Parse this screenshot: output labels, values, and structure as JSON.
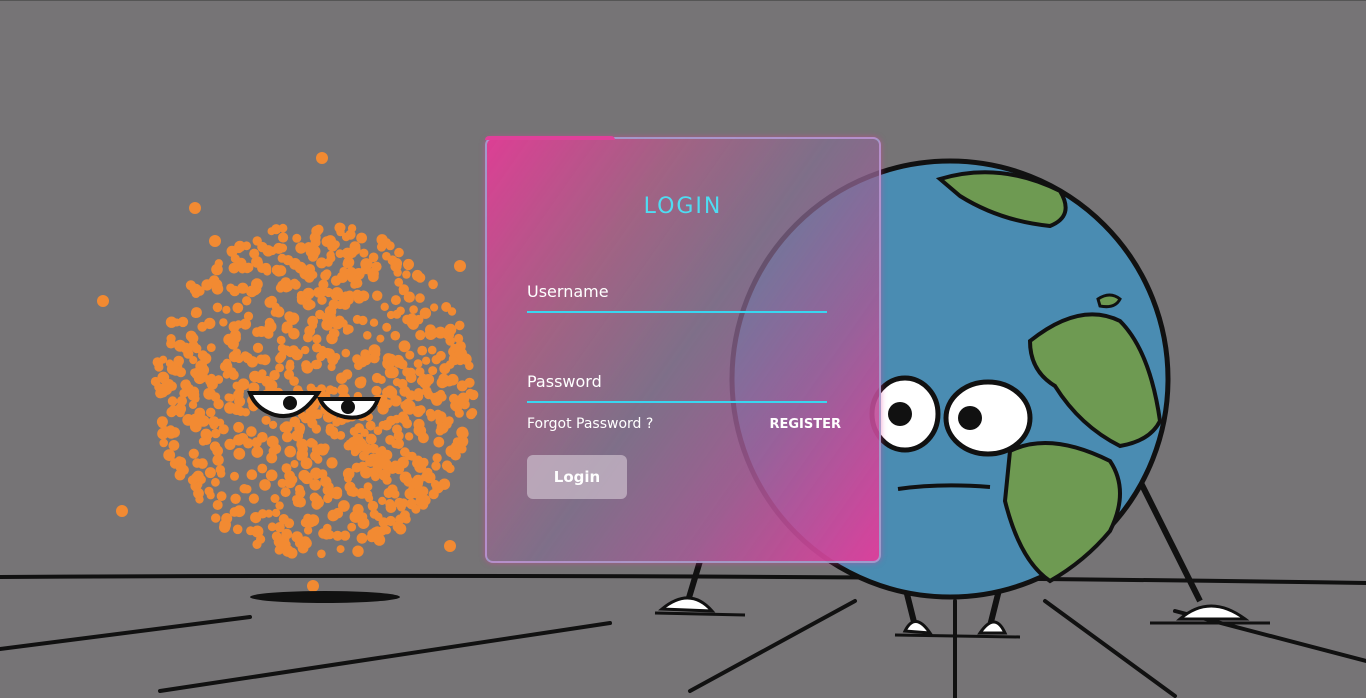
{
  "page": {
    "background_color": "#767476",
    "accent_color": "#4fdcf2",
    "card_gradient": [
      "#e23c96",
      "#826e91",
      "#de3e9b"
    ]
  },
  "illustration": {
    "characters": [
      "sun-character",
      "earth-character"
    ]
  },
  "login_form": {
    "title": "LOGIN",
    "username_label": "Username",
    "password_label": "Password",
    "forgot_password_link": "Forgot Password ?",
    "register_link": "REGISTER",
    "login_button": "Login"
  }
}
